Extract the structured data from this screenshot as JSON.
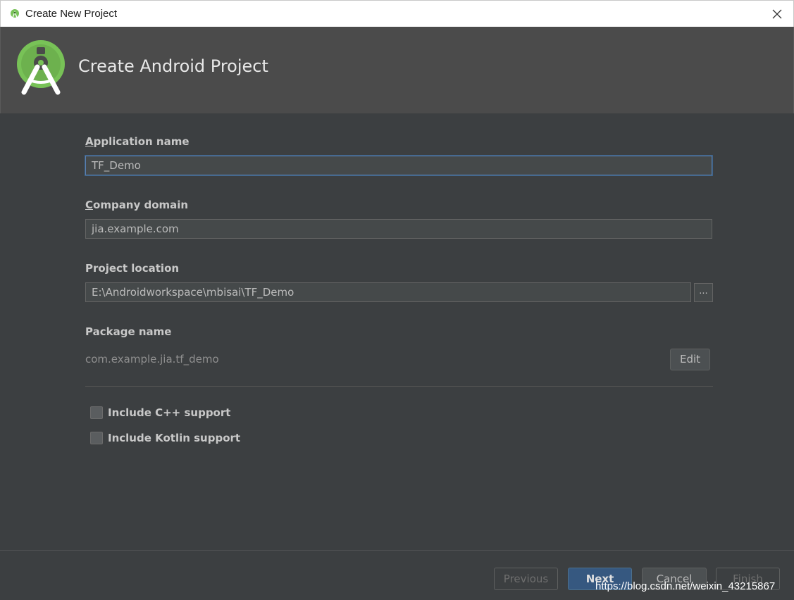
{
  "window": {
    "title": "Create New Project",
    "close_icon": "close-icon"
  },
  "header": {
    "title": "Create Android Project",
    "logo": "android-studio-logo"
  },
  "form": {
    "app_name": {
      "label": "Application name",
      "mnemonic": "A",
      "rest": "pplication name",
      "value": "TF_Demo"
    },
    "company_domain": {
      "label": "Company domain",
      "mnemonic": "C",
      "rest": "ompany domain",
      "value": "jia.example.com"
    },
    "project_location": {
      "label": "Project location",
      "value": "E:\\Androidworkspace\\mbisai\\TF_Demo",
      "browse_label": "..."
    },
    "package_name": {
      "label": "Package name",
      "value": "com.example.jia.tf_demo",
      "edit_label": "Edit"
    },
    "include_cpp": {
      "label": "Include C++ support",
      "checked": false
    },
    "include_kotlin": {
      "label": "Include Kotlin support",
      "checked": false
    }
  },
  "footer": {
    "previous": "Previous",
    "next": "Next",
    "cancel": "Cancel",
    "finish": "Finish",
    "watermark": "https://blog.csdn.net/weixin_43215867"
  },
  "colors": {
    "background": "#3c3f41",
    "header": "#4b4b4b",
    "accent": "#365880",
    "android_green": "#78c257"
  }
}
